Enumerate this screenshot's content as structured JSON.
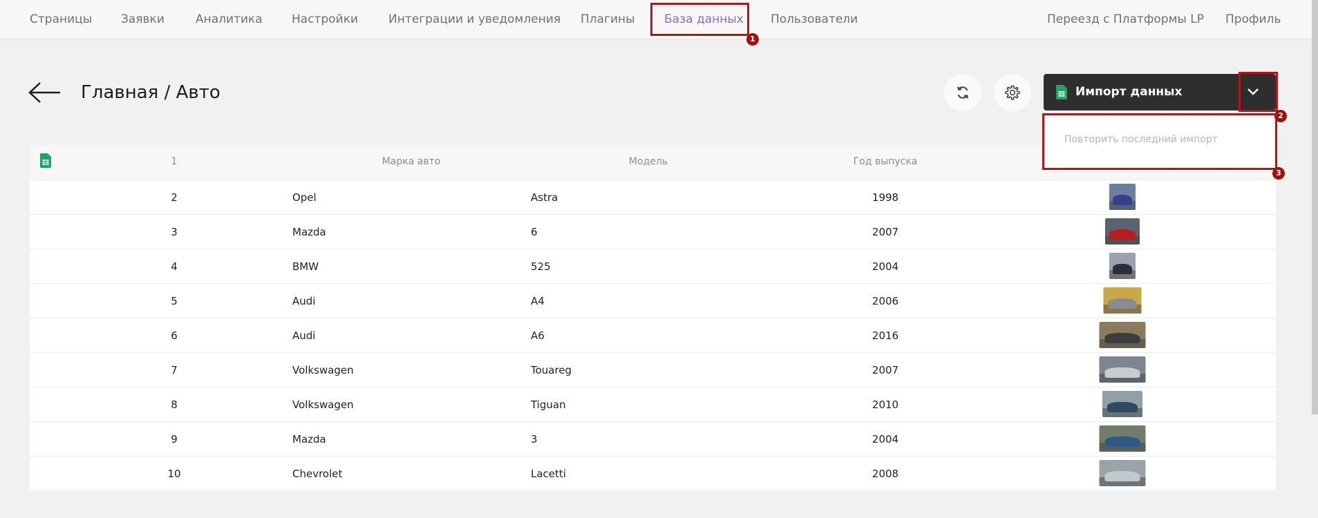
{
  "nav": {
    "items": [
      "Страницы",
      "Заявки",
      "Аналитика",
      "Настройки",
      "Интеграции и уведомления",
      "Плагины",
      "База данных",
      "Пользователи"
    ],
    "active": "База данных",
    "right": [
      "Переезд с Платформы LP",
      "Профиль"
    ]
  },
  "header": {
    "title": "Главная / Авто",
    "import_label": "Импорт данных"
  },
  "dropdown": {
    "item": "Повторить последний импорт"
  },
  "badges": [
    "1",
    "2",
    "3"
  ],
  "table": {
    "columns": [
      "1",
      "Марка авто",
      "Модель",
      "Год выпуска"
    ],
    "rows": [
      {
        "n": "2",
        "brand": "Opel",
        "model": "Astra",
        "year": "1998",
        "photo_color": "#3a3f8a",
        "bg": "#6d7f9e"
      },
      {
        "n": "3",
        "brand": "Mazda",
        "model": "6",
        "year": "2007",
        "photo_color": "#b51d21",
        "bg": "#5a6470"
      },
      {
        "n": "4",
        "brand": "BMW",
        "model": "525",
        "year": "2004",
        "photo_color": "#2c2f3a",
        "bg": "#9aa2ae"
      },
      {
        "n": "5",
        "brand": "Audi",
        "model": "A4",
        "year": "2006",
        "photo_color": "#8a8c90",
        "bg": "#c9a84a"
      },
      {
        "n": "6",
        "brand": "Audi",
        "model": "A6",
        "year": "2016",
        "photo_color": "#3a3c40",
        "bg": "#8c7a5c"
      },
      {
        "n": "7",
        "brand": "Volkswagen",
        "model": "Touareg",
        "year": "2007",
        "photo_color": "#c9ccd1",
        "bg": "#7d8590"
      },
      {
        "n": "8",
        "brand": "Volkswagen",
        "model": "Tiguan",
        "year": "2010",
        "photo_color": "#2f4a5e",
        "bg": "#8fa0a8"
      },
      {
        "n": "9",
        "brand": "Mazda",
        "model": "3",
        "year": "2004",
        "photo_color": "#2e5a86",
        "bg": "#6f7d6a"
      },
      {
        "n": "10",
        "brand": "Chevrolet",
        "model": "Lacetti",
        "year": "2008",
        "photo_color": "#c4c7cc",
        "bg": "#9aa3a8"
      }
    ]
  },
  "colors": {
    "accent": "#8c6cc9",
    "highlight": "#b01818",
    "import_bg": "#2e2e2e",
    "sheets_green": "#1fa463"
  }
}
